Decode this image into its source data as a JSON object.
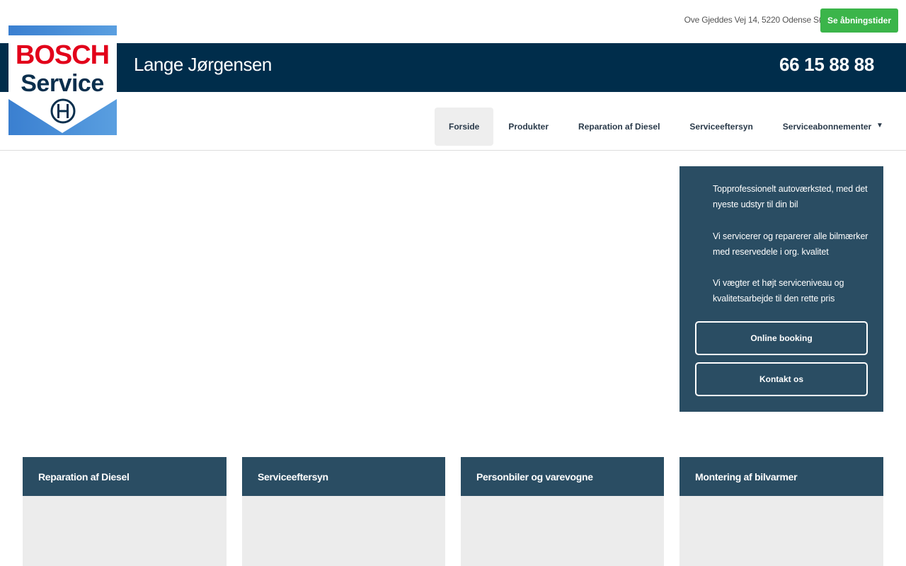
{
  "header": {
    "address": "Ove Gjeddes Vej 14, 5220 Odense SØ",
    "hours_button": "Se åbningstider",
    "company_name": "Lange Jørgensen",
    "phone": "66 15 88 88"
  },
  "logo": {
    "line1": "BOSCH",
    "line2": "Service",
    "accent_red": "#e2001a",
    "navy": "#0a2f4d",
    "blue": "#4a8fd6"
  },
  "nav": {
    "items": [
      {
        "label": "Forside",
        "active": true
      },
      {
        "label": "Produkter"
      },
      {
        "label": "Reparation af Diesel"
      },
      {
        "label": "Serviceeftersyn"
      },
      {
        "label": "Serviceabonnementer"
      }
    ],
    "more_glyph": "▼"
  },
  "info": {
    "lines": [
      "Topprofessionelt autoværksted, med det nyeste udstyr til din bil",
      "Vi servicerer og reparerer alle bilmærker med reservedele i org. kvalitet",
      "Vi vægter et højt serviceniveau og kvalitetsarbejde til den rette pris"
    ],
    "booking_button": "Online booking",
    "contact_button": "Kontakt os"
  },
  "cards": [
    {
      "title": "Reparation af Diesel"
    },
    {
      "title": "Serviceeftersyn"
    },
    {
      "title": "Personbiler og varevogne"
    },
    {
      "title": "Montering af bilvarmer"
    }
  ],
  "colors": {
    "banner": "#002d4b",
    "panel": "#2a4d63",
    "green": "#3bb54a"
  }
}
